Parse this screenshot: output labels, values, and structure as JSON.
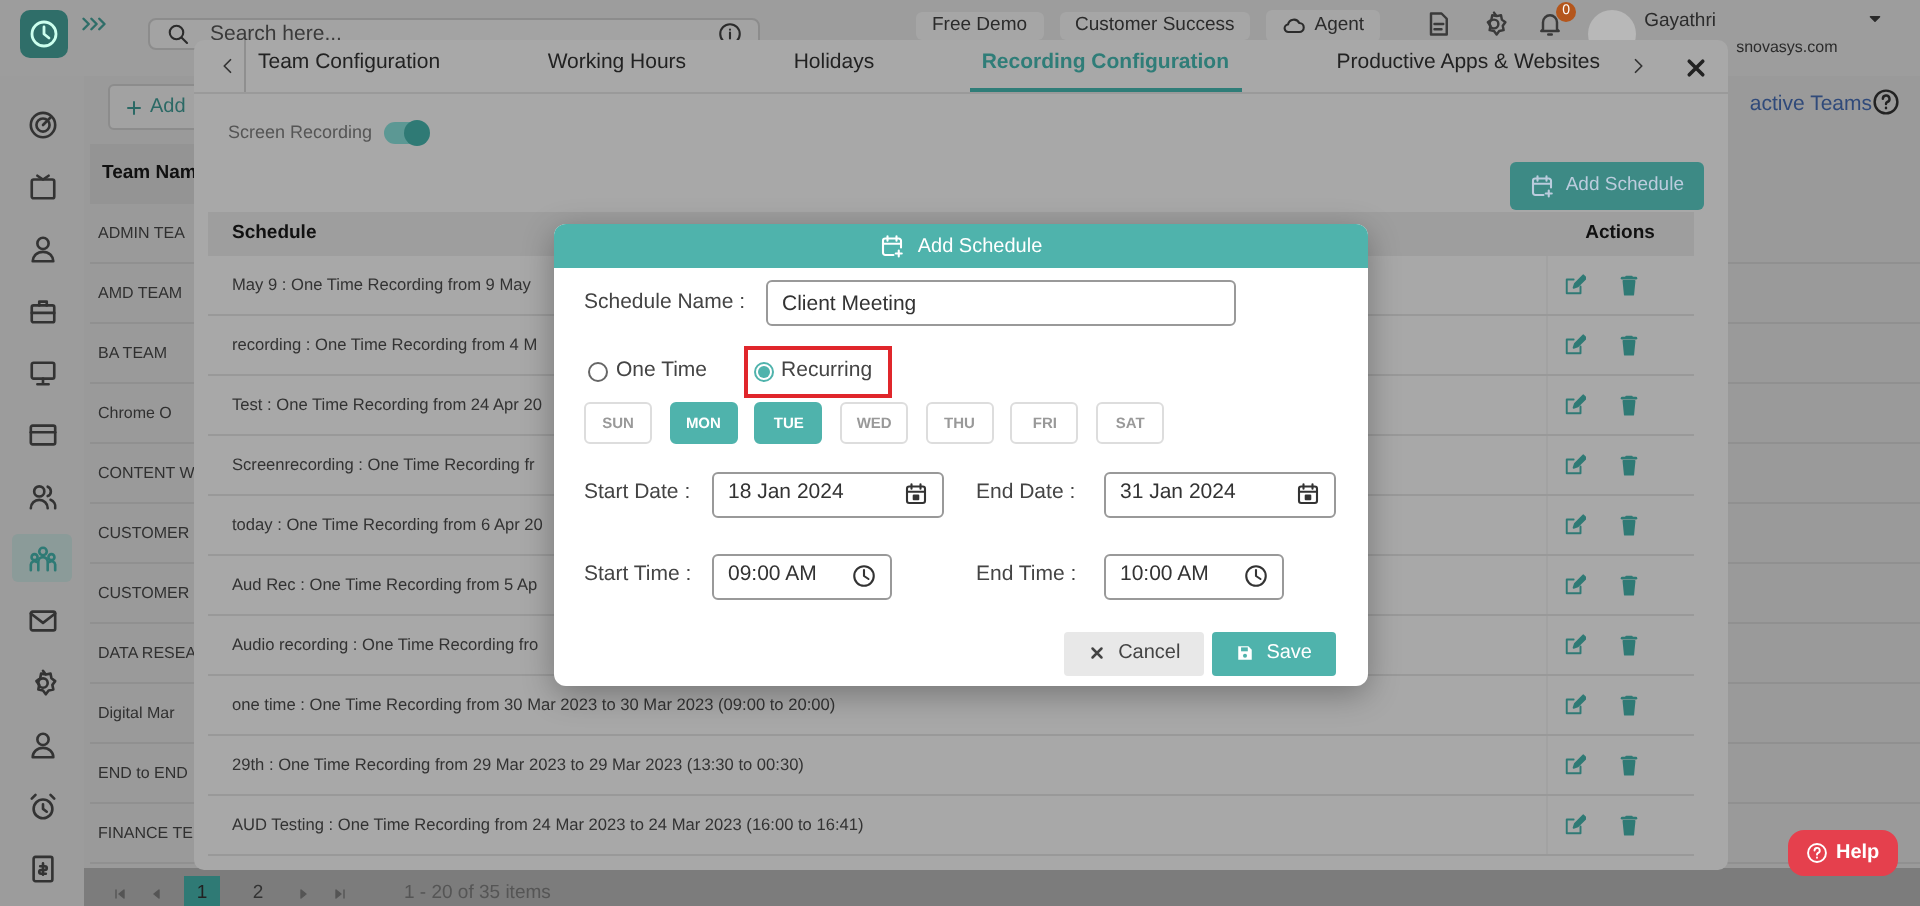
{
  "top_bar": {
    "search_placeholder": "Search here...",
    "links": [
      {
        "label": "Free Demo"
      },
      {
        "label": "Customer Success"
      },
      {
        "label": "Agent"
      }
    ],
    "notification_count": "0",
    "user": {
      "name": "Gayathri",
      "email": "snovasys.com"
    }
  },
  "sidebar": {
    "items": [
      {
        "selected": false
      },
      {
        "selected": false
      },
      {
        "selected": false
      },
      {
        "selected": false
      },
      {
        "selected": false
      },
      {
        "selected": false
      },
      {
        "selected": false
      },
      {
        "selected": true
      },
      {
        "selected": false
      },
      {
        "selected": false
      },
      {
        "selected": false
      },
      {
        "selected": false
      },
      {
        "selected": false
      }
    ]
  },
  "teams": {
    "add_label": "Add",
    "inactive_link": "active Teams",
    "column": "Team Nam",
    "rows": [
      "ADMIN TEA",
      "AMD TEAM",
      "BA TEAM",
      "Chrome O",
      "CONTENT W",
      "CUSTOMER",
      "CUSTOMER",
      "DATA RESEA",
      "Digital Mar",
      "END to END",
      "FINANCE TE"
    ],
    "pagination": {
      "pages": [
        {
          "label": "1",
          "selected": true
        },
        {
          "label": "2",
          "selected": false
        }
      ],
      "summary": "1 - 20 of 35 items"
    }
  },
  "team_settings": {
    "tabs": [
      {
        "label": "Team Configuration",
        "selected": false
      },
      {
        "label": "Working Hours",
        "selected": false
      },
      {
        "label": "Holidays",
        "selected": false
      },
      {
        "label": "Recording Configuration",
        "selected": true
      },
      {
        "label": "Productive Apps & Websites",
        "selected": false
      }
    ],
    "screen_recording": {
      "label": "Screen Recording",
      "on": true
    },
    "add_button": "Add Schedule",
    "table": {
      "columns": [
        "Schedule",
        "Actions"
      ],
      "rows": [
        "May 9 : One Time Recording from 9 May",
        "recording : One Time Recording from 4 M",
        "Test : One Time Recording from 24 Apr 20",
        "Screenrecording : One Time Recording fr",
        "today : One Time Recording from 6 Apr 20",
        "Aud Rec : One Time Recording from 5 Ap",
        "Audio recording : One Time Recording fro",
        "one time : One Time Recording from 30 Mar 2023 to 30 Mar 2023 (09:00 to 20:00)",
        "29th : One Time Recording from 29 Mar 2023 to 29 Mar 2023 (13:30 to 00:30)",
        "AUD Testing : One Time Recording from 24 Mar 2023 to 24 Mar 2023 (16:00 to 16:41)"
      ]
    }
  },
  "dialog": {
    "title": "Add Schedule",
    "name_label": "Schedule Name :",
    "name_value": "Client Meeting",
    "modes": [
      {
        "label": "One Time",
        "selected": false,
        "highlighted": false
      },
      {
        "label": "Recurring",
        "selected": true,
        "highlighted": true
      }
    ],
    "days": [
      {
        "label": "SUN",
        "selected": false
      },
      {
        "label": "MON",
        "selected": true
      },
      {
        "label": "TUE",
        "selected": true
      },
      {
        "label": "WED",
        "selected": false
      },
      {
        "label": "THU",
        "selected": false
      },
      {
        "label": "FRI",
        "selected": false
      },
      {
        "label": "SAT",
        "selected": false
      }
    ],
    "start_date": {
      "label": "Start Date :",
      "value": "18 Jan 2024"
    },
    "end_date": {
      "label": "End Date :",
      "value": "31 Jan 2024"
    },
    "start_time": {
      "label": "Start Time :",
      "value": "09:00 AM"
    },
    "end_time": {
      "label": "End Time :",
      "value": "10:00 AM"
    },
    "buttons": [
      {
        "kind": "cancel",
        "label": "Cancel"
      },
      {
        "kind": "save",
        "label": "Save"
      }
    ]
  },
  "help_button": "Help"
}
